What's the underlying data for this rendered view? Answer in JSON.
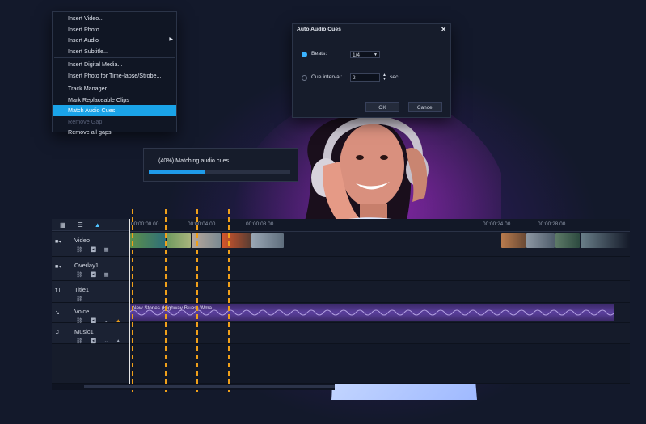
{
  "context_menu": {
    "items": [
      {
        "label": "Insert Video..."
      },
      {
        "label": "Insert Photo..."
      },
      {
        "label": "Insert Audio",
        "submenu": true
      },
      {
        "label": "Insert Subtitle..."
      },
      {
        "label": "Insert Digital Media..."
      },
      {
        "label": "Insert Photo for Time-lapse/Strobe..."
      },
      {
        "label": "Track Manager..."
      },
      {
        "label": "Mark Replaceable Clips"
      },
      {
        "label": "Match Audio Cues",
        "selected": true
      },
      {
        "label": "Remove Gap",
        "disabled": true
      },
      {
        "label": "Remove all gaps"
      }
    ]
  },
  "dialog": {
    "title": "Auto Audio Cues",
    "close": "✕",
    "beats_label": "Beats:",
    "beats_value": "1/4",
    "cue_interval_label": "Cue interval:",
    "cue_interval_value": "2",
    "cue_interval_unit": "sec",
    "ok_label": "OK",
    "cancel_label": "Cancel"
  },
  "progress": {
    "text": "(40%) Matching audio cues...",
    "percent": 40
  },
  "timeline": {
    "ruler_ticks": [
      "00:00:00.00",
      "00:00:04.00",
      "00:00:08.00",
      "00:00:24.00",
      "00:00:28.00"
    ],
    "tracks": [
      {
        "name": "Video",
        "icon": "video-track-icon"
      },
      {
        "name": "Overlay1",
        "icon": "overlay-track-icon"
      },
      {
        "name": "Title1",
        "icon": "title-track-icon"
      },
      {
        "name": "Voice",
        "icon": "voice-track-icon"
      },
      {
        "name": "Music1",
        "icon": "music-track-icon"
      }
    ],
    "audio_clip_name": "New Stories (Highway Blues).Wma"
  },
  "colors": {
    "accent": "#1aa3e8",
    "cue_marker": "#f0a01a",
    "audio_clip": "#5b3f9d"
  }
}
